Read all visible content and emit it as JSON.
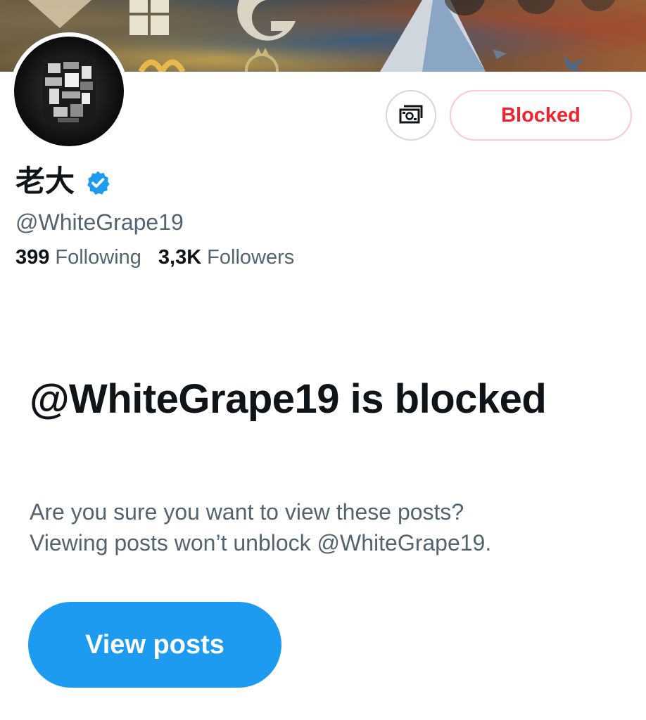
{
  "header": {
    "subscribe_icon": "money-icon",
    "blocked_label": "Blocked"
  },
  "profile": {
    "display_name": "老大",
    "verified_icon": "verified-badge-icon",
    "handle": "@WhiteGrape19",
    "following_count": "399",
    "following_label": "Following",
    "followers_count": "3,3K",
    "followers_label": "Followers"
  },
  "blocked_notice": {
    "title": "@WhiteGrape19 is blocked",
    "body_line1": "Are you sure you want to view these posts?",
    "body_line2": "Viewing posts won’t unblock @WhiteGrape19.",
    "view_posts_label": "View posts"
  },
  "colors": {
    "accent": "#1d9bf0",
    "blocked_red": "#f4212e",
    "secondary_text": "#536471"
  }
}
